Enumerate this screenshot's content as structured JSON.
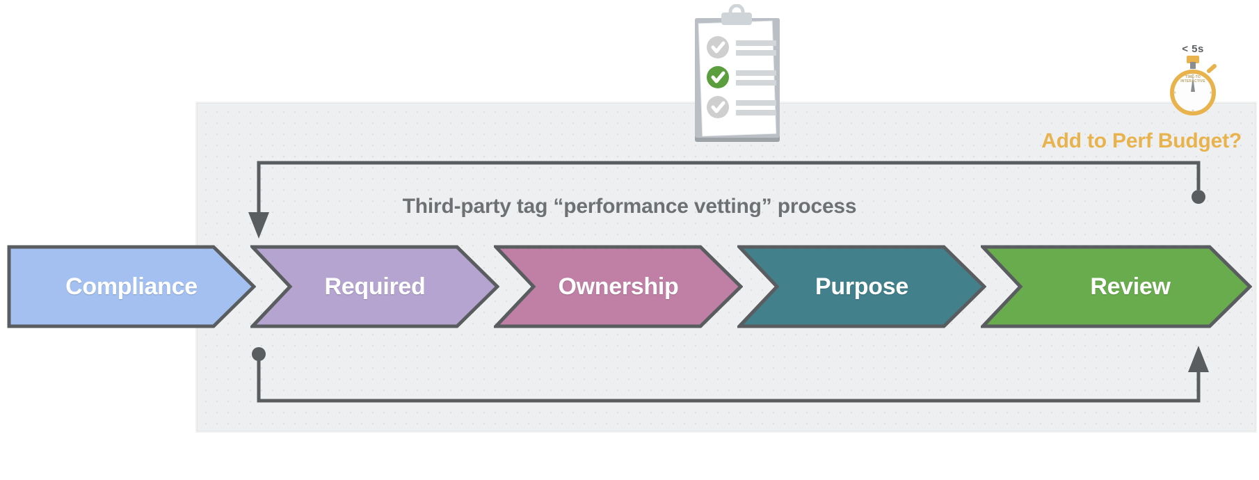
{
  "diagram": {
    "title": "Third-party tag “performance vetting” process",
    "perf_budget_label": "Add to Perf Budget?",
    "panel_bg": "#eeeff1",
    "accent_amber": "#e8b34c",
    "line_color": "#5a5d60"
  },
  "steps": [
    {
      "label": "Compliance",
      "color": "#a3c0f0",
      "border": "#5a5d60"
    },
    {
      "label": "Required",
      "color": "#b4a4cf",
      "border": "#5a5d60"
    },
    {
      "label": "Ownership",
      "color": "#c07fa4",
      "border": "#5a5d60"
    },
    {
      "label": "Purpose",
      "color": "#42808c",
      "border": "#5a5d60"
    },
    {
      "label": "Review",
      "color": "#69ac4d",
      "border": "#5a5d60"
    }
  ],
  "stopwatch": {
    "time_label": "< 5s",
    "dial_line1": "TIME-TO",
    "dial_line2": "INTERACTIVE",
    "ring_color": "#e8b34c"
  },
  "clipboard": {
    "check_states": [
      "unchecked",
      "checked",
      "unchecked"
    ],
    "checked_color": "#5a9e3e",
    "unchecked_color": "#cfcfcf"
  },
  "loops": {
    "top": {
      "start": "dot",
      "end": "arrow",
      "direction": "right-to-left"
    },
    "bottom": {
      "start": "dot",
      "end": "arrow",
      "direction": "left-to-right"
    }
  }
}
